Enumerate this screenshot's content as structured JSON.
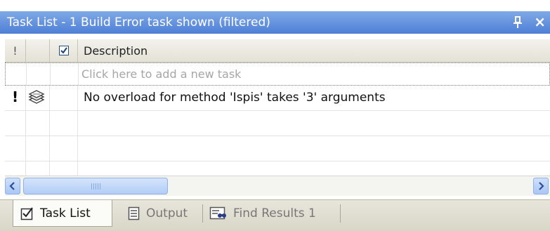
{
  "window": {
    "title": "Task List - 1 Build Error task shown (filtered)",
    "pin_icon": "pin-icon",
    "close_label": "×"
  },
  "grid": {
    "columns": {
      "priority": "!",
      "category": "",
      "checked": "checkbox",
      "description": "Description"
    },
    "new_task_placeholder": "Click here to add a new task",
    "rows": [
      {
        "priority_mark": "!",
        "category_icon": "build-error-icon",
        "description": "No overload for method 'Ispis' takes '3' arguments"
      }
    ]
  },
  "tabs": [
    {
      "label": "Task List",
      "icon": "task-list-icon",
      "active": true
    },
    {
      "label": "Output",
      "icon": "output-icon",
      "active": false
    },
    {
      "label": "Find Results 1",
      "icon": "find-results-icon",
      "active": false
    }
  ],
  "colors": {
    "titlebar_start": "#7fa9e6",
    "titlebar_end": "#4f7fd6",
    "scroll_accent": "#b3cdf6"
  }
}
